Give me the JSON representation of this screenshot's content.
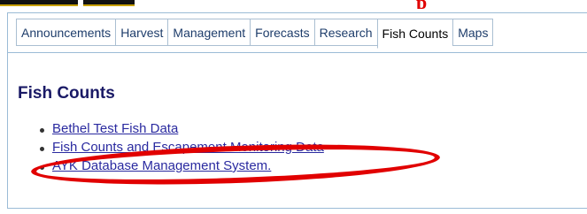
{
  "tabs": [
    "Announcements",
    "Harvest",
    "Management",
    "Forecasts",
    "Research",
    "Fish Counts",
    "Maps"
  ],
  "active_tab": "Fish Counts",
  "heading": "Fish Counts",
  "links": [
    "Bethel Test Fish Data",
    "Fish Counts and Escapement Monitoring Data",
    "AYK Database Management System."
  ],
  "top_red_text": "p",
  "colors": {
    "tab_text": "#1e3d6b",
    "heading": "#1a1a66",
    "link": "#2a2aa0",
    "highlight_oval": "#e10000",
    "border": "#9bbbd6"
  }
}
